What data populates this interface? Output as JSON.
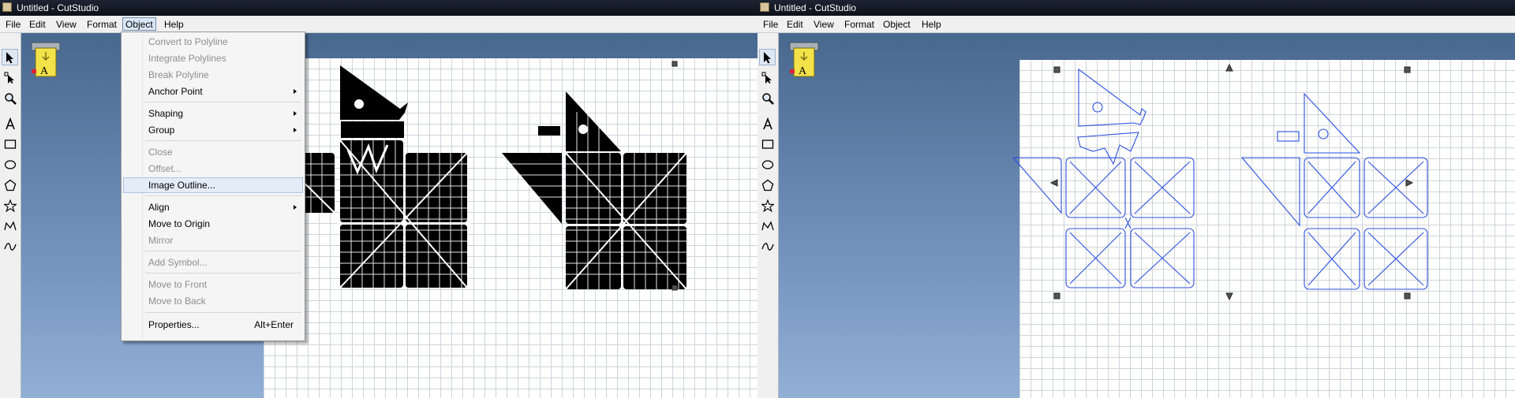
{
  "colors": {
    "titlebar": "#0d1119",
    "workspace_top": "#48688f",
    "workspace_bottom": "#92afd6",
    "outline_stroke": "#2a4fe0",
    "fill_black": "#000000"
  },
  "left_window": {
    "title": "Untitled - CutStudio",
    "menu": [
      "File",
      "Edit",
      "View",
      "Format",
      "Object",
      "Help"
    ],
    "active_menu": "Object",
    "object_menu": {
      "items": [
        {
          "label": "Convert to Polyline",
          "enabled": false
        },
        {
          "label": "Integrate Polylines",
          "enabled": false
        },
        {
          "label": "Break Polyline",
          "enabled": false
        },
        {
          "label": "Anchor Point",
          "enabled": true,
          "submenu": true
        },
        {
          "label": "Shaping",
          "enabled": true,
          "submenu": true
        },
        {
          "label": "Group",
          "enabled": true,
          "submenu": true
        },
        {
          "label": "Close",
          "enabled": false
        },
        {
          "label": "Offset...",
          "enabled": false
        },
        {
          "label": "Image Outline...",
          "enabled": true,
          "highlighted": true
        },
        {
          "label": "Align",
          "enabled": true,
          "submenu": true
        },
        {
          "label": "Move to Origin",
          "enabled": true
        },
        {
          "label": "Mirror",
          "enabled": false
        },
        {
          "label": "Add Symbol...",
          "enabled": false
        },
        {
          "label": "Move to Front",
          "enabled": false
        },
        {
          "label": "Move to Back",
          "enabled": false
        },
        {
          "label": "Properties...",
          "enabled": true,
          "shortcut": "Alt+Enter"
        }
      ]
    }
  },
  "right_window": {
    "title": "Untitled - CutStudio",
    "menu": [
      "File",
      "Edit",
      "View",
      "Format",
      "Object",
      "Help"
    ]
  },
  "toolbar_tools": [
    "select-arrow-icon",
    "edit-points-icon",
    "zoom-icon",
    "text-icon",
    "rectangle-icon",
    "ellipse-icon",
    "polygon-icon",
    "star-icon",
    "polyline-icon",
    "curve-icon"
  ],
  "printer_icon_label": "A"
}
